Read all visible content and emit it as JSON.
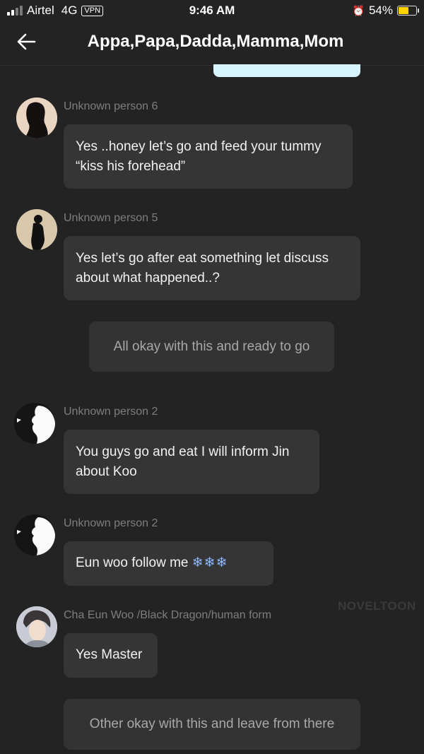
{
  "status": {
    "carrier": "Airtel",
    "network": "4G",
    "vpn": "VPN",
    "time": "9:46 AM",
    "battery": "54%",
    "battery_level": 0.54
  },
  "header": {
    "title": "Appa,Papa,Dadda,Mamma,Mom"
  },
  "messages": [
    {
      "sender": "Unknown person 6",
      "text": "Yes ..honey let’s go and feed your tummy “kiss his forehead”"
    },
    {
      "sender": "Unknown person 5",
      "text": "Yes let’s go after eat something let discuss about what happened..?"
    },
    {
      "system": "All okay with this and ready to go"
    },
    {
      "sender": "Unknown person 2",
      "text": "You guys go and eat I will inform Jin about Koo"
    },
    {
      "sender": "Unknown person 2",
      "text": "Eun woo follow me",
      "emoji": "❄❄❄"
    },
    {
      "sender": "Cha Eun Woo /Black Dragon/human form",
      "text": "Yes Master"
    },
    {
      "system": "Other okay with this and leave from there"
    }
  ],
  "watermark": "NOVELTOON"
}
